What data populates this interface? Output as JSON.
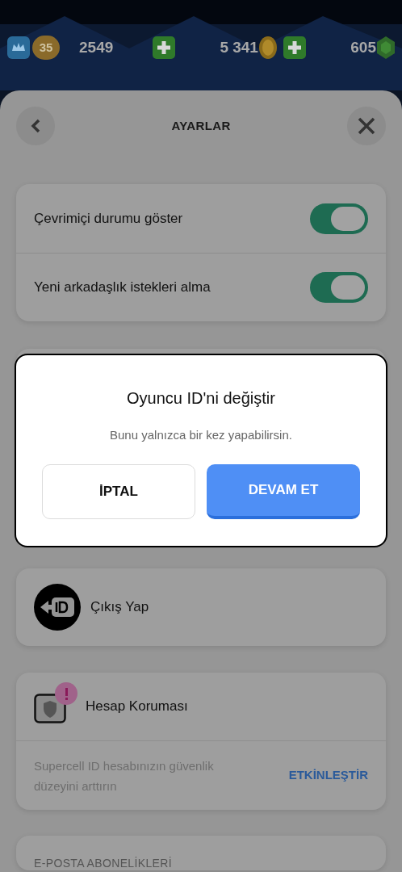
{
  "top_bar": {
    "level": "35",
    "trophies": "2549",
    "gold": "5 341",
    "gems": "605"
  },
  "header": {
    "title": "AYARLAR"
  },
  "toggles": [
    {
      "label": "Çevrimiçi durumu göster",
      "on": true
    },
    {
      "label": "Yeni arkadaşlık istekleri alma",
      "on": true
    }
  ],
  "dialog": {
    "title": "Oyuncu ID'ni değiştir",
    "message": "Bunu yalnızca bir kez yapabilirsin.",
    "buttons": [
      {
        "label": "İPTAL",
        "kind": "secondary"
      },
      {
        "label": "DEVAM ET",
        "kind": "primary"
      }
    ]
  },
  "logout": {
    "label": "Çıkış Yap"
  },
  "account_protection": {
    "title": "Hesap Koruması",
    "alert": true,
    "description": "Supercell ID hesabınızın güvenlik düzeyini arttırın",
    "action": "ETKİNLEŞTİR"
  },
  "email_section": {
    "title": "E-POSTA ABONELİKLERİ"
  }
}
